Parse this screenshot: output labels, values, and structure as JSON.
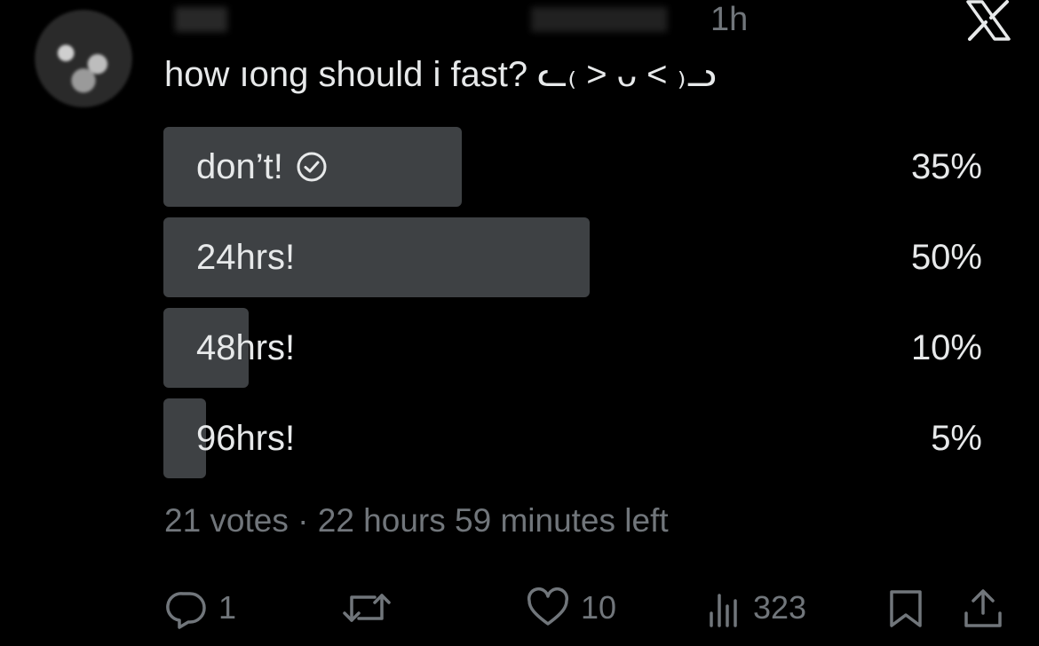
{
  "tweet": {
    "timestamp": "1h",
    "text": "how ıong should i fast? ᓚ₍ ˃ ᴗ ˂ ₎ᓗ"
  },
  "poll": {
    "options": [
      {
        "label": "don’t!",
        "percent_text": "35%",
        "percent": 35,
        "selected": true
      },
      {
        "label": "24hrs!",
        "percent_text": "50%",
        "percent": 50,
        "selected": false
      },
      {
        "label": "48hrs!",
        "percent_text": "10%",
        "percent": 10,
        "selected": false
      },
      {
        "label": "96hrs!",
        "percent_text": "5%",
        "percent": 5,
        "selected": false
      }
    ],
    "meta": "21 votes · 22 hours 59 minutes left"
  },
  "actions": {
    "replies": "1",
    "reposts": "",
    "likes": "10",
    "views": "323"
  },
  "icons": {
    "logo": "x-logo-icon",
    "selected": "check-circle-icon",
    "reply": "reply-icon",
    "repost": "repost-icon",
    "like": "heart-icon",
    "views": "views-icon",
    "bookmark": "bookmark-icon",
    "share": "share-icon"
  },
  "colors": {
    "background": "#000000",
    "text": "#e7e9ea",
    "muted": "#71767b",
    "bar": "#3e4144"
  }
}
